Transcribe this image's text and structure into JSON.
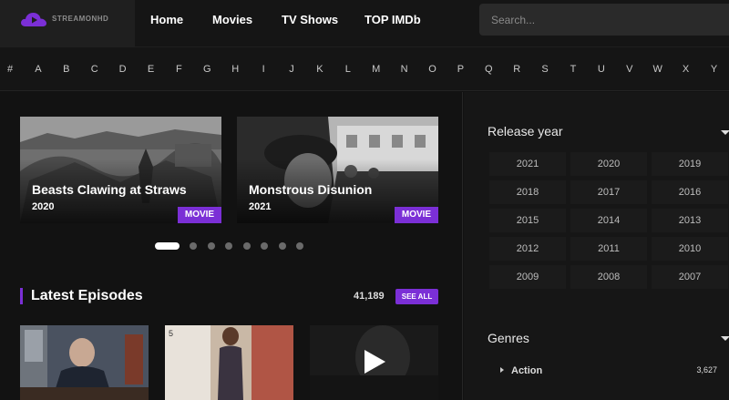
{
  "header": {
    "logo_text": "STREAMONHD",
    "nav": [
      {
        "label": "Home"
      },
      {
        "label": "Movies"
      },
      {
        "label": "TV Shows"
      },
      {
        "label": "TOP IMDb"
      }
    ],
    "search_placeholder": "Search..."
  },
  "alphabet": [
    "#",
    "A",
    "B",
    "C",
    "D",
    "E",
    "F",
    "G",
    "H",
    "I",
    "J",
    "K",
    "L",
    "M",
    "N",
    "O",
    "P",
    "Q",
    "R",
    "S",
    "T",
    "U",
    "V",
    "W",
    "X",
    "Y"
  ],
  "featured": [
    {
      "title": "Beasts Clawing at Straws",
      "year": "2020",
      "type": "MOVIE"
    },
    {
      "title": "Monstrous Disunion",
      "year": "2021",
      "type": "MOVIE"
    }
  ],
  "carousel": {
    "total": 8,
    "active": 1
  },
  "latest": {
    "title": "Latest Episodes",
    "count": "41,189",
    "see_all": "SEE ALL"
  },
  "sidebar": {
    "release_year_title": "Release year",
    "years": [
      "2021",
      "2020",
      "2019",
      "2018",
      "2017",
      "2016",
      "2015",
      "2014",
      "2013",
      "2012",
      "2011",
      "2010",
      "2009",
      "2008",
      "2007"
    ],
    "genres_title": "Genres",
    "genres": [
      {
        "name": "Action",
        "count": "3,627"
      }
    ]
  },
  "colors": {
    "accent": "#7b2fd6",
    "background": "#121212",
    "header": "#151515"
  },
  "icons": {
    "logo": "play-cloud-icon",
    "play": "play-icon",
    "caret": "caret-down-icon",
    "genre_arrow": "chevron-right-icon"
  }
}
